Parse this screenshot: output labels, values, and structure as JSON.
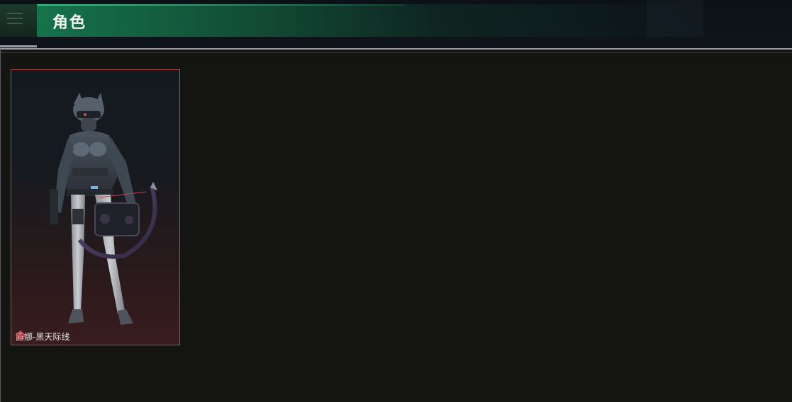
{
  "header": {
    "title": "角色"
  },
  "characters": [
    {
      "name": "露娜-黑天际线",
      "icon": "rarity-diamond-icon",
      "accent_color": "#b2484c"
    }
  ],
  "colors": {
    "header_accent": "#16784e",
    "card_border": "#b2484c",
    "background": "#141412"
  }
}
